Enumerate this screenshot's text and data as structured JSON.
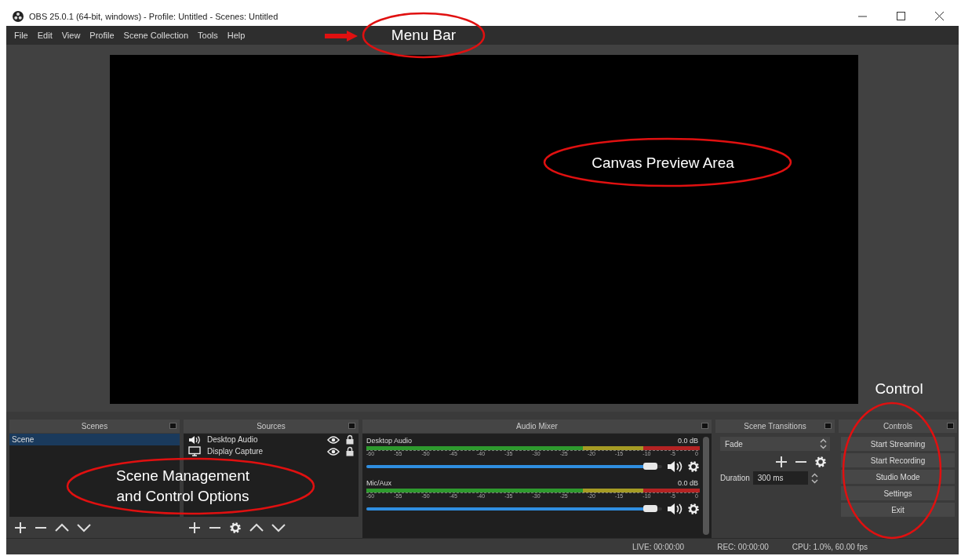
{
  "window": {
    "title": "OBS 25.0.1 (64-bit, windows) - Profile: Untitled - Scenes: Untitled"
  },
  "menu_bar": [
    "File",
    "Edit",
    "View",
    "Profile",
    "Scene Collection",
    "Tools",
    "Help"
  ],
  "scenes": {
    "title": "Scenes",
    "items": [
      {
        "label": "Scene",
        "selected": true
      }
    ]
  },
  "sources": {
    "title": "Sources",
    "items": [
      {
        "kind": "audio",
        "label": "Desktop Audio"
      },
      {
        "kind": "display",
        "label": "Display Capture"
      }
    ]
  },
  "audio_mixer": {
    "title": "Audio Mixer",
    "channels": [
      {
        "name": "Desktop Audio",
        "reading": "0.0 dB",
        "level": 0.96,
        "scale": [
          "-60",
          "-55",
          "-50",
          "-45",
          "-40",
          "-35",
          "-30",
          "-25",
          "-20",
          "-15",
          "-10",
          "-5",
          "0"
        ]
      },
      {
        "name": "Mic/Aux",
        "reading": "0.0 dB",
        "level": 0.96,
        "scale": [
          "-60",
          "-55",
          "-50",
          "-45",
          "-40",
          "-35",
          "-30",
          "-25",
          "-20",
          "-15",
          "-10",
          "-5",
          "0"
        ]
      }
    ]
  },
  "scene_transitions": {
    "title": "Scene Transitions",
    "transition": "Fade",
    "duration_label": "Duration",
    "duration": "300 ms"
  },
  "controls": {
    "title": "Controls",
    "buttons": [
      "Start Streaming",
      "Start Recording",
      "Studio Mode",
      "Settings",
      "Exit"
    ]
  },
  "status_bar": {
    "live": "LIVE: 00:00:00",
    "rec": "REC: 00:00:00",
    "cpu": "CPU: 1.0%, 60.00 fps"
  },
  "annotations": [
    {
      "kind": "arrow-ellipse",
      "text": "Menu Bar"
    },
    {
      "kind": "ellipse",
      "text": "Canvas Preview Area"
    },
    {
      "kind": "ellipse",
      "text": "Scene Management and Control Options"
    },
    {
      "kind": "caption-ellipse",
      "text": "Control"
    }
  ]
}
